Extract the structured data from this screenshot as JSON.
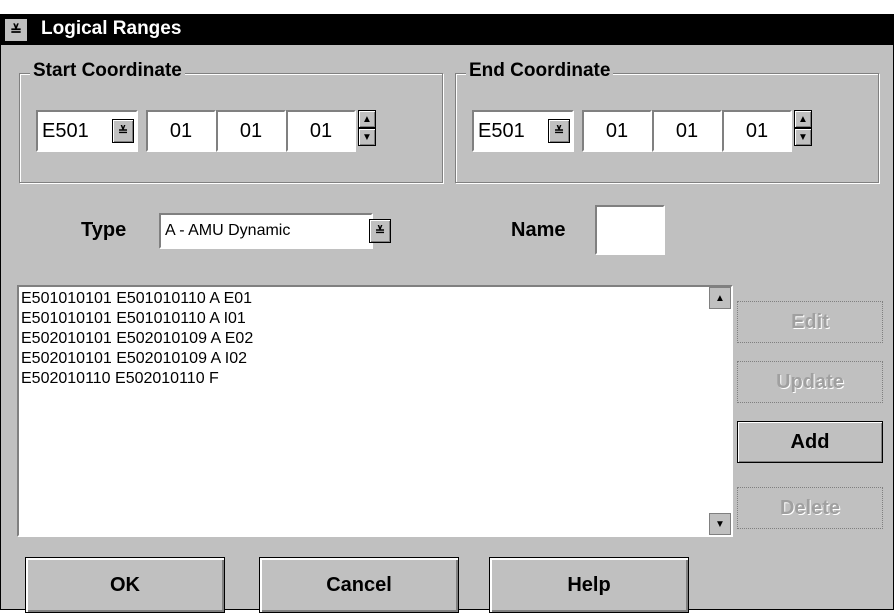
{
  "window": {
    "title": "Logical Ranges",
    "sysmenu_glyph": "≡"
  },
  "start_coordinate": {
    "label": "Start Coordinate",
    "site": "E501",
    "f1": "01",
    "f2": "01",
    "f3": "01"
  },
  "end_coordinate": {
    "label": "End Coordinate",
    "site": "E501",
    "f1": "01",
    "f2": "01",
    "f3": "01"
  },
  "type": {
    "label": "Type",
    "value": "A - AMU Dynamic"
  },
  "name": {
    "label": "Name",
    "value": ""
  },
  "ranges_list": [
    "E501010101 E501010110 A E01",
    "E501010101 E501010110 A I01",
    "E502010101 E502010109 A E02",
    "E502010101 E502010109 A I02",
    "E502010110 E502010110 F"
  ],
  "side_buttons": {
    "edit": "Edit",
    "update": "Update",
    "add": "Add",
    "delete": "Delete"
  },
  "bottom_buttons": {
    "ok": "OK",
    "cancel": "Cancel",
    "help": "Help"
  },
  "icons": {
    "dropdown": "dropdown-arrow-icon",
    "spin_up": "up-arrow-icon",
    "spin_down": "down-arrow-icon",
    "scroll_up": "scroll-up-icon",
    "scroll_down": "scroll-down-icon"
  },
  "colors": {
    "dialog_bg": "#c0c0c0",
    "titlebar_bg": "#000000",
    "disabled_text": "#a0a0a0"
  }
}
